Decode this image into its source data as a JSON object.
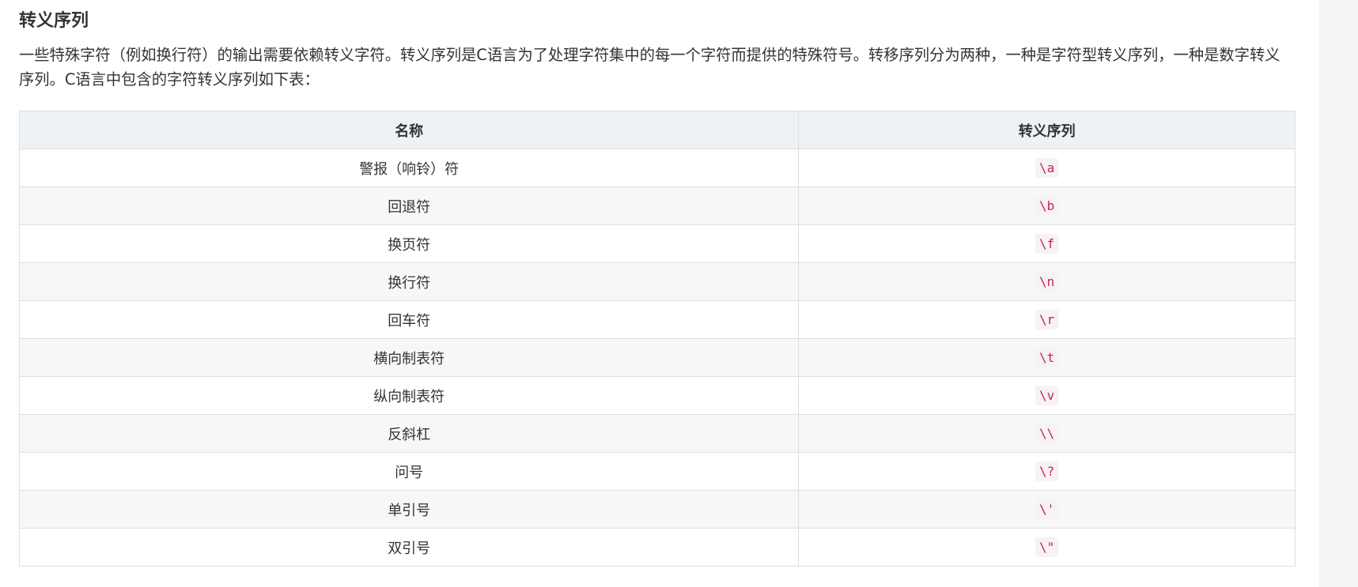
{
  "heading": "转义序列",
  "intro": "一些特殊字符（例如换行符）的输出需要依赖转义字符。转义序列是C语言为了处理字符集中的每一个字符而提供的特殊符号。转移序列分为两种，一种是字符型转义序列，一种是数字转义序列。C语言中包含的字符转义序列如下表：",
  "table": {
    "headers": [
      "名称",
      "转义序列"
    ],
    "rows": [
      {
        "name": "警报（响铃）符",
        "seq": "\\a"
      },
      {
        "name": "回退符",
        "seq": "\\b"
      },
      {
        "name": "换页符",
        "seq": "\\f"
      },
      {
        "name": "换行符",
        "seq": "\\n"
      },
      {
        "name": "回车符",
        "seq": "\\r"
      },
      {
        "name": "横向制表符",
        "seq": "\\t"
      },
      {
        "name": "纵向制表符",
        "seq": "\\v"
      },
      {
        "name": "反斜杠",
        "seq": "\\\\"
      },
      {
        "name": "问号",
        "seq": "\\?"
      },
      {
        "name": "单引号",
        "seq": "\\'"
      },
      {
        "name": "双引号",
        "seq": "\\\""
      }
    ]
  },
  "colors": {
    "code_text": "#c7254e",
    "code_bg": "#f7f2f4",
    "header_bg": "#eff2f5",
    "stripe_bg": "#f7f7f7",
    "border": "#dedede"
  }
}
